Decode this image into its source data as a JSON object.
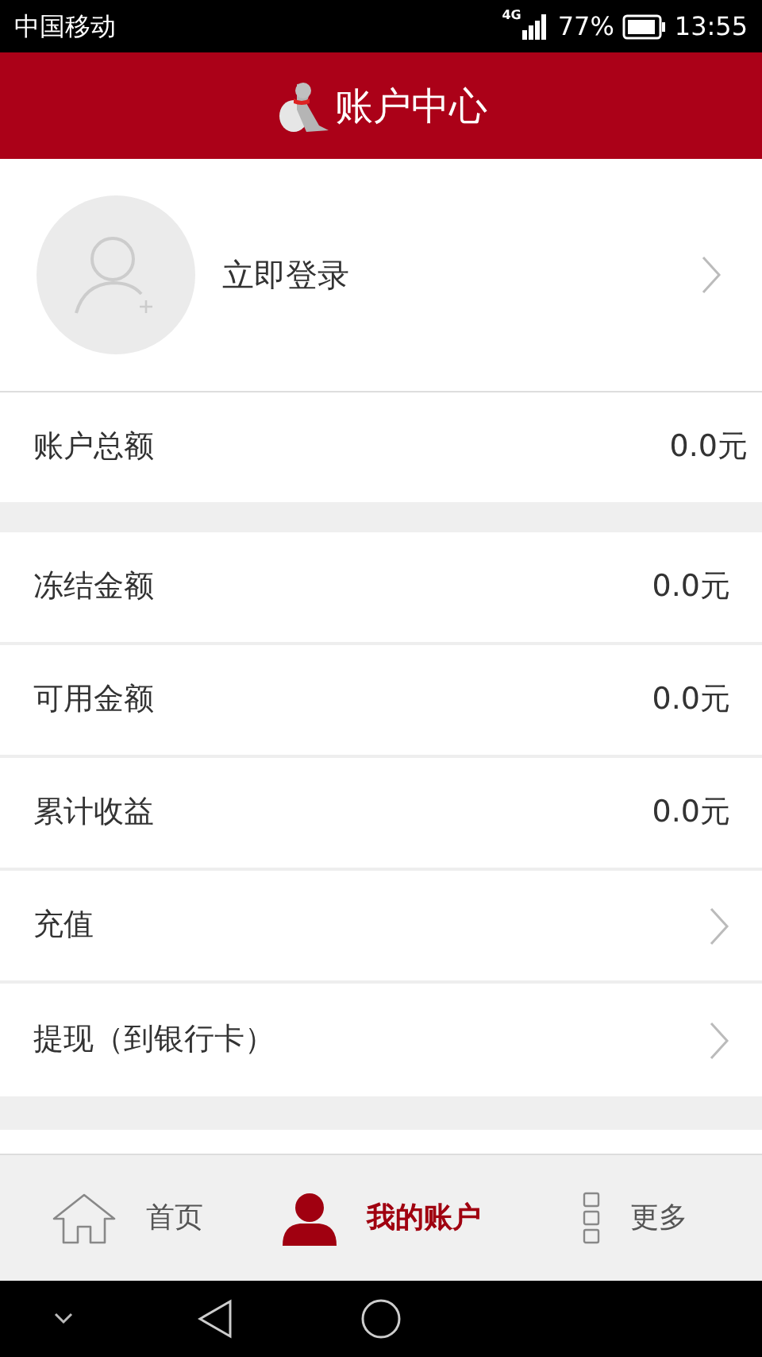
{
  "status_bar": {
    "carrier": "中国移动",
    "network": "4G",
    "battery": "77%",
    "time": "13:55"
  },
  "header": {
    "title": "账户中心"
  },
  "login": {
    "label": "立即登录"
  },
  "total": {
    "label": "账户总额",
    "value": "0.0元"
  },
  "rows": [
    {
      "kind": "value",
      "label": "冻结金额",
      "value": "0.0元"
    },
    {
      "kind": "value",
      "label": "可用金额",
      "value": "0.0元"
    },
    {
      "kind": "value",
      "label": "累计收益",
      "value": "0.0元"
    },
    {
      "kind": "link",
      "label": "充值"
    },
    {
      "kind": "link",
      "label": "提现（到银行卡）"
    }
  ],
  "tab_bar": [
    {
      "kind": "home",
      "label": "首页",
      "selected": false
    },
    {
      "kind": "account",
      "label": "我的账户",
      "selected": true
    },
    {
      "kind": "more",
      "label": "更多",
      "selected": false
    }
  ]
}
